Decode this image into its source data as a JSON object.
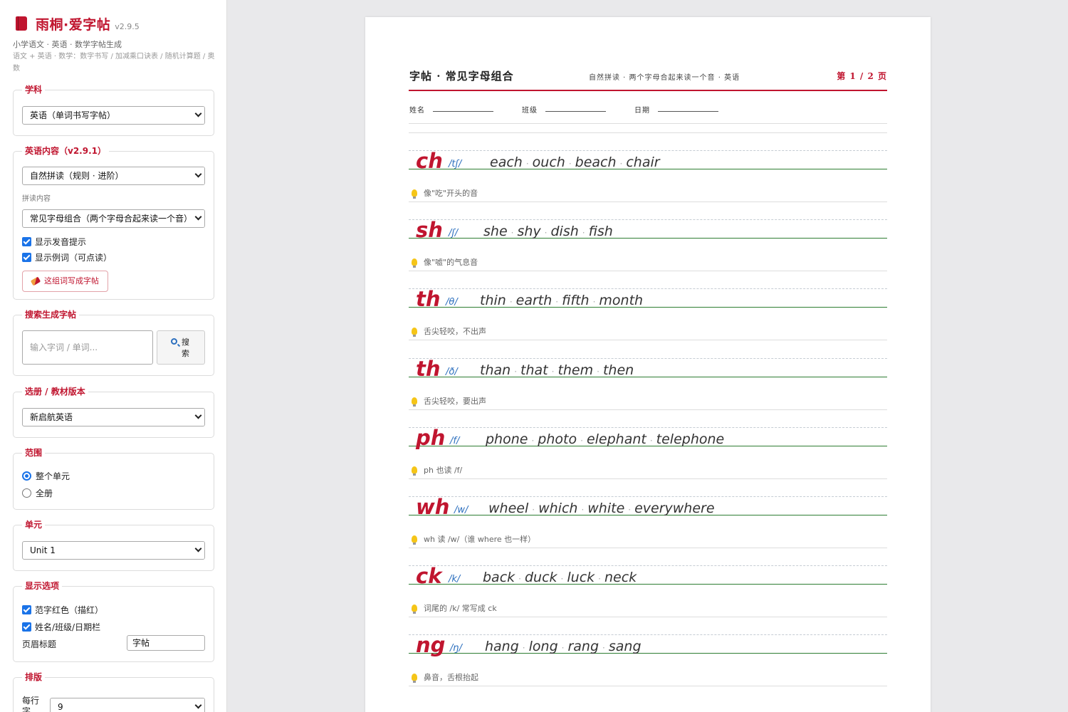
{
  "app": {
    "title": "雨桐·爱字帖",
    "version": "v2.9.5",
    "subtitle": "小学语文 · 英语 · 数学字帖生成",
    "description": "语文 + 英语 · 数学：数字书写 / 加减乘口诀表 / 随机计算题 / 奥数"
  },
  "sidebar": {
    "subject": {
      "legend": "学科",
      "value": "英语（单词书写字帖）"
    },
    "english": {
      "legend": "英语内容（v2.9.1）",
      "mode_value": "自然拼读（规则 · 进阶）",
      "content_label": "拼读内容",
      "content_value": "常见字母组合（两个字母合起来读一个音）",
      "show_pron": "显示发音提示",
      "show_examples": "显示例词（可点读）",
      "make_button": "这组词写成字帖"
    },
    "search": {
      "legend": "搜索生成字帖",
      "placeholder": "输入字词 / 单词...",
      "button": "搜索"
    },
    "textbook": {
      "legend": "选册 / 教材版本",
      "value": "新启航英语"
    },
    "range": {
      "legend": "范围",
      "opt_unit": "整个单元",
      "opt_all": "全册"
    },
    "unit": {
      "legend": "单元",
      "value": "Unit 1"
    },
    "display": {
      "legend": "显示选项",
      "red_sample": "范字红色（描红）",
      "name_bar": "姓名/班级/日期栏",
      "header_label": "页眉标题",
      "header_value": "字帖"
    },
    "layout": {
      "legend": "排版",
      "rows_label": "每行字",
      "rows_value": "9"
    }
  },
  "sheet": {
    "title": "字帖 · 常见字母组合",
    "subtitle": "自然拼读 · 两个字母合起来读一个音 · 英语",
    "page": "第 1 / 2 页",
    "name_label": "姓名",
    "class_label": "班级",
    "date_label": "日期",
    "rows": [
      {
        "combo": "ch",
        "ipa": "/tʃ/",
        "words": [
          "each",
          "ouch",
          "beach",
          "chair"
        ],
        "hint": "像\"吃\"开头的音"
      },
      {
        "combo": "sh",
        "ipa": "/ʃ/",
        "words": [
          "she",
          "shy",
          "dish",
          "fish"
        ],
        "hint": "像\"嘘\"的气息音"
      },
      {
        "combo": "th",
        "ipa": "/θ/",
        "words": [
          "thin",
          "earth",
          "fifth",
          "month"
        ],
        "hint": "舌尖轻咬，不出声"
      },
      {
        "combo": "th",
        "ipa": "/ð/",
        "words": [
          "than",
          "that",
          "them",
          "then"
        ],
        "hint": "舌尖轻咬，要出声"
      },
      {
        "combo": "ph",
        "ipa": "/f/",
        "words": [
          "phone",
          "photo",
          "elephant",
          "telephone"
        ],
        "hint": "ph 也读 /f/"
      },
      {
        "combo": "wh",
        "ipa": "/w/",
        "words": [
          "wheel",
          "which",
          "white",
          "everywhere"
        ],
        "hint": "wh 读 /w/（谁 where 也一样）"
      },
      {
        "combo": "ck",
        "ipa": "/k/",
        "words": [
          "back",
          "duck",
          "luck",
          "neck"
        ],
        "hint": "词尾的 /k/ 常写成 ck"
      },
      {
        "combo": "ng",
        "ipa": "/ŋ/",
        "words": [
          "hang",
          "long",
          "rang",
          "sang"
        ],
        "hint": "鼻音，舌根抬起"
      }
    ]
  },
  "colors": {
    "accent": "#c0152f",
    "baseline": "#2e7d32",
    "ipa": "#2c6fbe",
    "control": "#1a73e8"
  }
}
